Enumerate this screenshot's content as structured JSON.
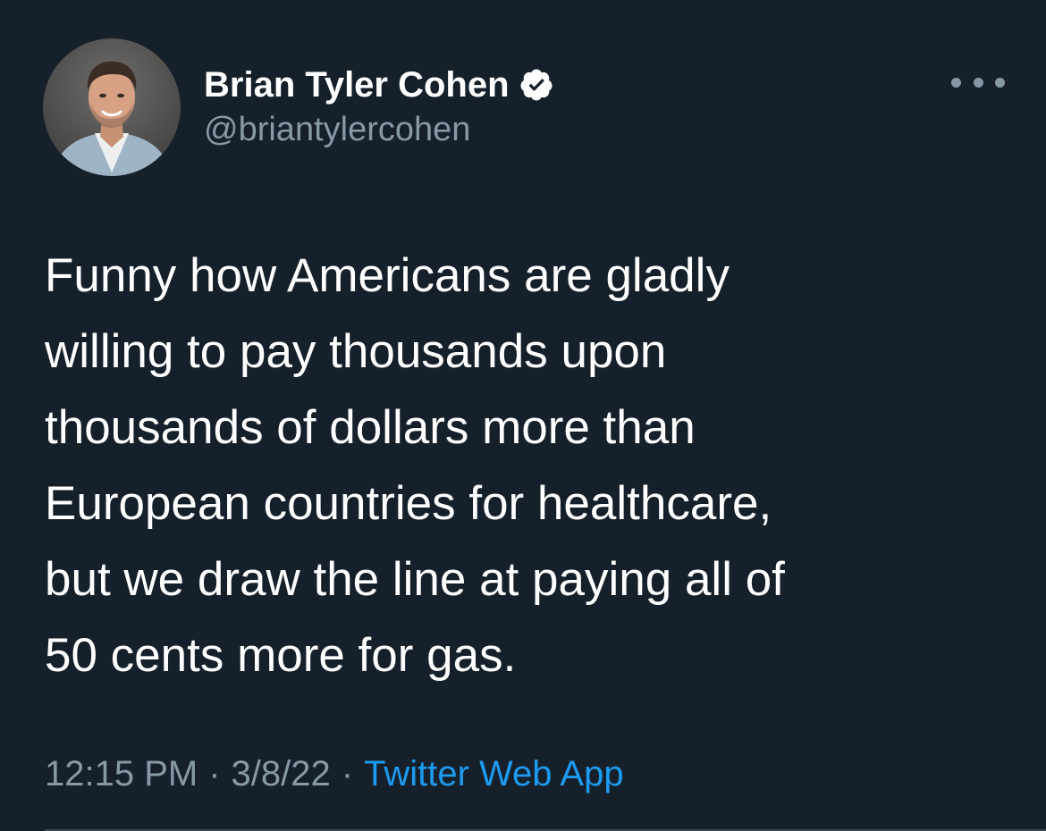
{
  "author": {
    "display_name": "Brian Tyler Cohen",
    "handle": "@briantylercohen",
    "verified": true,
    "avatar_icon": "profile-photo"
  },
  "tweet": {
    "text": "Funny how Americans are gladly\nwilling to pay thousands upon\nthousands of dollars more than\nEuropean countries for healthcare,\nbut we draw the line at paying all of\n50 cents more for gas."
  },
  "meta": {
    "time": "12:15 PM",
    "separator": "·",
    "date": "3/8/22",
    "source": "Twitter Web App"
  },
  "icons": {
    "more": "more-horizontal-icon",
    "verified": "verified-badge-icon"
  },
  "colors": {
    "background": "#15202b",
    "primary_text": "#ffffff",
    "secondary_text": "#8899a6",
    "accent": "#1d9bf0"
  }
}
